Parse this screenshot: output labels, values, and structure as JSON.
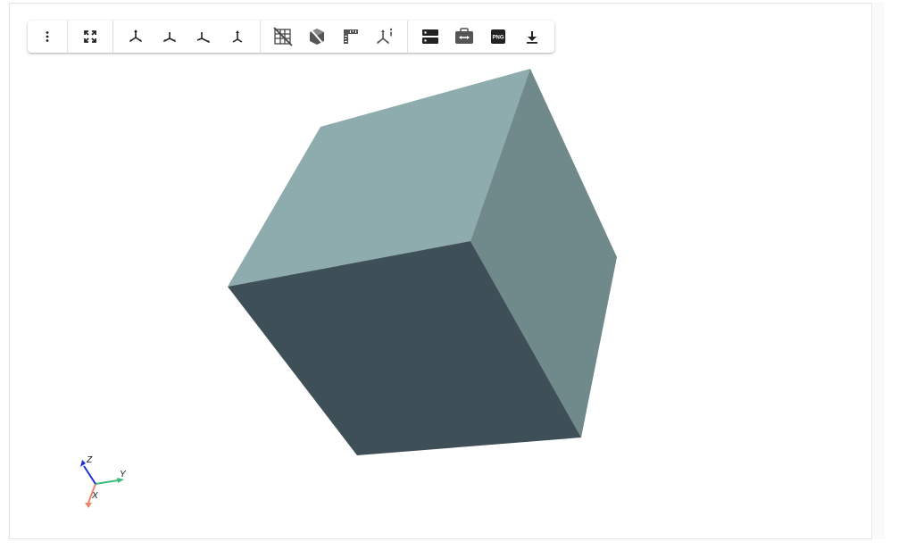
{
  "toolbar": {
    "groups": [
      {
        "name": "menu",
        "buttons": [
          {
            "icon": "more-vert-icon",
            "tooltip": ""
          }
        ]
      },
      {
        "name": "fit",
        "buttons": [
          {
            "icon": "fullscreen-icon",
            "tooltip": ""
          }
        ]
      },
      {
        "name": "views",
        "buttons": [
          {
            "icon": "axes-iso-icon",
            "tooltip": ""
          },
          {
            "icon": "axes-front-icon",
            "tooltip": ""
          },
          {
            "icon": "axes-side-icon",
            "tooltip": ""
          },
          {
            "icon": "axes-top-icon",
            "tooltip": ""
          }
        ]
      },
      {
        "name": "tools",
        "buttons": [
          {
            "icon": "grid-off-icon",
            "tooltip": ""
          },
          {
            "icon": "cube-clip-icon",
            "tooltip": ""
          },
          {
            "icon": "ruler-icon",
            "tooltip": ""
          },
          {
            "icon": "axes-info-icon",
            "tooltip": ""
          }
        ]
      },
      {
        "name": "export",
        "buttons": [
          {
            "icon": "storage-icon",
            "tooltip": ""
          },
          {
            "icon": "explode-icon",
            "tooltip": ""
          },
          {
            "icon": "png-export-icon",
            "tooltip": "",
            "text": "PNG"
          },
          {
            "icon": "download-icon",
            "tooltip": ""
          }
        ]
      }
    ]
  },
  "scene": {
    "colors": {
      "top_face": "#8eabad",
      "side_face": "#70898b",
      "front_face": "#3f4f58",
      "background": "#ffffff"
    }
  },
  "axes_triad": {
    "labels": {
      "x": "X",
      "y": "Y",
      "z": "Z"
    },
    "colors": {
      "x": "#e8876a",
      "y": "#3fba7a",
      "z": "#1f2fcf"
    }
  }
}
